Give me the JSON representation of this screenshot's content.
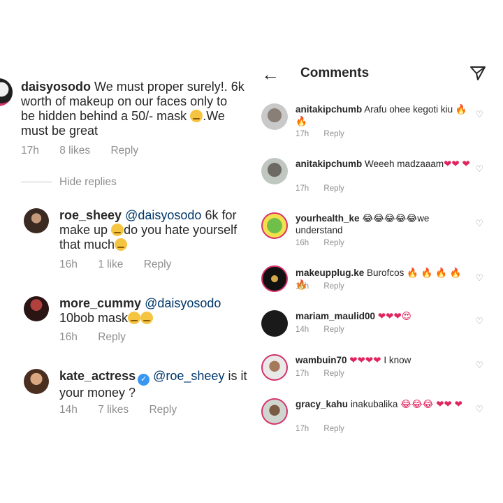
{
  "left_panel": {
    "main_comment": {
      "username": "daisyosodo",
      "text": "We must proper surely!. 6k worth of makeup on our faces only to be hidden behind a 50/- mask",
      "text_tail": ".We must be great",
      "time": "17h",
      "likes": "8 likes",
      "reply": "Reply"
    },
    "hide_replies": "Hide replies",
    "replies": [
      {
        "username": "roe_sheey",
        "mention": "@daisyosodo",
        "text_a": "6k for make up",
        "text_b": "do you hate yourself that much",
        "time": "16h",
        "likes": "1 like",
        "reply": "Reply"
      },
      {
        "username": "more_cummy",
        "mention": "@daisyosodo",
        "text_a": "10bob mask",
        "time": "16h",
        "reply": "Reply"
      },
      {
        "username": "kate_actress",
        "mention": "@roe_sheey",
        "text_a": "is it your money ?",
        "time": "14h",
        "likes": "7 likes",
        "reply": "Reply"
      }
    ]
  },
  "right_panel": {
    "header": {
      "back_icon": "arrow-left-icon",
      "title": "Comments",
      "send_icon": "paper-plane-icon"
    },
    "comments": [
      {
        "username": "anitakipchumb",
        "text": "Arafu ohee kegoti kiu",
        "emoji": "🔥 🔥",
        "time": "17h",
        "reply": "Reply"
      },
      {
        "username": "anitakipchumb",
        "text": "Weeeh madzaaam",
        "emoji": "❤❤ ❤",
        "time": "17h",
        "reply": "Reply"
      },
      {
        "username": "yourhealth_ke",
        "text": "we understand",
        "emoji": "😂😂😂😂😂",
        "time": "16h",
        "reply": "Reply"
      },
      {
        "username": "makeupplug.ke",
        "text": "Burofcos",
        "emoji": "🔥 🔥 🔥 🔥 🔥",
        "time": "16h",
        "reply": "Reply"
      },
      {
        "username": "mariam_maulid00",
        "text": "",
        "emoji": "❤❤❤😍",
        "time": "14h",
        "reply": "Reply"
      },
      {
        "username": "wambuin70",
        "text": "I know",
        "emoji": "❤❤❤❤",
        "time": "17h",
        "reply": "Reply"
      },
      {
        "username": "gracy_kahu",
        "text": "inakubalika",
        "emoji": "😂😂😂 ❤❤ ❤",
        "time": "17h",
        "reply": "Reply"
      }
    ]
  },
  "colors": {
    "text": "#262626",
    "muted": "#8e8e8e",
    "mention": "#00376b",
    "heart": "#e0245e",
    "verified": "#3897f0"
  }
}
